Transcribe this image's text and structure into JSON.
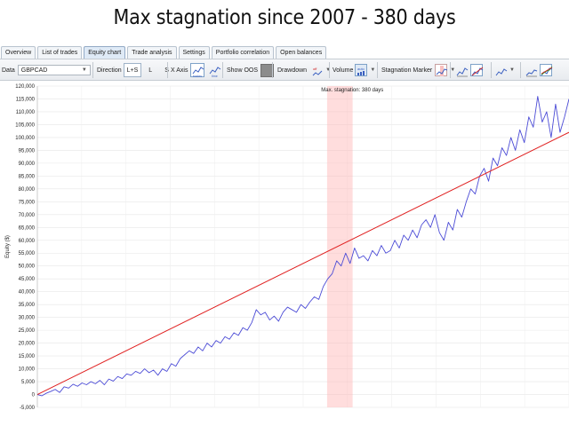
{
  "headline": "Max stagnation since 2007 - 380 days",
  "tabs": [
    {
      "label": "Overview",
      "active": false
    },
    {
      "label": "List of trades",
      "active": false
    },
    {
      "label": "Equity chart",
      "active": true
    },
    {
      "label": "Trade analysis",
      "active": false
    },
    {
      "label": "Settings",
      "active": false
    },
    {
      "label": "Portfolio correlation",
      "active": false
    },
    {
      "label": "Open balances",
      "active": false
    }
  ],
  "toolbar": {
    "data_label": "Data",
    "data_value": "GBPCAD",
    "direction_label": "Direction",
    "direction_options": [
      "L+S",
      "L",
      "S"
    ],
    "direction_selected": "L+S",
    "xaxis_label": "X Axis",
    "xaxis_trades": "trades",
    "xaxis_time": "time",
    "show_oos_label": "Show OOS",
    "drawdown_label": "Drawdown",
    "drawdown_icon_text": "off",
    "volume_label": "Volume",
    "volume_icon_text": "auto",
    "stagnation_label": "Stagnation Marker"
  },
  "chart_data": {
    "type": "line",
    "ylabel": "Equity ($)",
    "ylim": [
      -5000,
      120000
    ],
    "yticks": [
      "120,000",
      "115,000",
      "110,000",
      "105,000",
      "100,000",
      "95,000",
      "90,000",
      "85,000",
      "80,000",
      "75,000",
      "70,000",
      "65,000",
      "60,000",
      "55,000",
      "50,000",
      "45,000",
      "40,000",
      "35,000",
      "30,000",
      "25,000",
      "20,000",
      "15,000",
      "10,000",
      "5,000",
      "0",
      "-5,000"
    ],
    "x_points": 100,
    "series": [
      {
        "color": "#4c4cd6",
        "values": [
          0,
          -500,
          500,
          1200,
          2000,
          800,
          3000,
          2500,
          4000,
          3200,
          4500,
          3800,
          5000,
          4200,
          5500,
          3800,
          6000,
          5200,
          7000,
          6200,
          8000,
          7500,
          9000,
          8200,
          10000,
          8500,
          9500,
          7500,
          10000,
          9000,
          12000,
          11000,
          14000,
          15500,
          17000,
          16000,
          18500,
          17000,
          20000,
          18500,
          21000,
          20000,
          22500,
          21500,
          24000,
          23000,
          26000,
          25000,
          28000,
          33000,
          31000,
          32000,
          29000,
          30500,
          28500,
          32000,
          34000,
          33000,
          32000,
          35000,
          33500,
          36000,
          38000,
          37000,
          42000,
          45000,
          47000,
          52000,
          50000,
          55000,
          51000,
          57000,
          53000,
          54000,
          52000,
          56000,
          54000,
          58000,
          55000,
          56000,
          60000,
          57000,
          62000,
          60000,
          64000,
          61000,
          66000,
          68000,
          65000,
          70000,
          63000,
          60000,
          67000,
          64000,
          72000,
          69000,
          75000,
          80000,
          78000,
          85000,
          88000,
          83000,
          92000,
          89000,
          96000,
          93000,
          100000,
          95000,
          103000,
          98000,
          108000,
          104000,
          116000,
          106000,
          110000,
          100000,
          113000,
          102000,
          108000,
          115000
        ],
        "name": ""
      },
      {
        "color": "#e02020",
        "values": [
          0,
          102000
        ],
        "name": ""
      }
    ],
    "stagnation": {
      "label": "Max. stagnation: 380 days",
      "start_fraction": 0.545,
      "end_fraction": 0.593,
      "color": "#ffb3b3"
    },
    "grid": true
  }
}
